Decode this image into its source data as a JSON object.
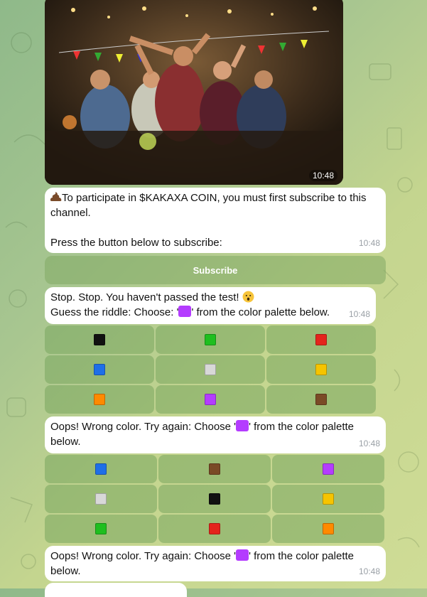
{
  "photo": {
    "time": "10:48"
  },
  "msg1": {
    "line1": "To participate in $KAKAXA COIN, you must first subscribe to this channel.",
    "line2": "Press the button below to subscribe:",
    "time": "10:48"
  },
  "subscribe_button": "Subscribe",
  "msg2": {
    "line1": "Stop. Stop. You haven't passed the test!",
    "line2_pre": "Guess the riddle: Choose: '",
    "line2_post": "' from the color palette below.",
    "time": "10:48"
  },
  "grid1": [
    [
      "#111111",
      "#1fbf1f",
      "#e4241c"
    ],
    [
      "#1e6fe8",
      "#d8d8d8",
      "#f6c400"
    ],
    [
      "#ff8a00",
      "#b43cff",
      "#7a4a26"
    ]
  ],
  "msg3": {
    "pre": "Oops! Wrong color. Try again: Choose '",
    "post": "' from the color palette below.",
    "time": "10:48"
  },
  "grid2": [
    [
      "#1e6fe8",
      "#7a4a26",
      "#b43cff"
    ],
    [
      "#d8d8d8",
      "#111111",
      "#f6c400"
    ],
    [
      "#1fbf1f",
      "#e4241c",
      "#ff8a00"
    ]
  ],
  "msg4": {
    "pre": "Oops! Wrong color. Try again: Choose '",
    "post": "' from the color palette below.",
    "time": "10:48"
  },
  "target_color": "#b43cff"
}
